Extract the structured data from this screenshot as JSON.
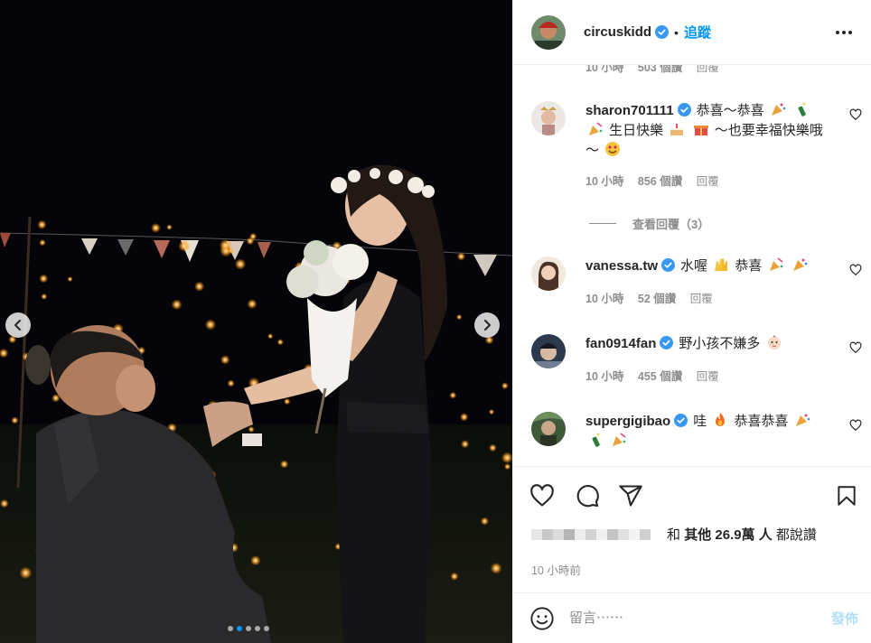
{
  "post": {
    "author": "circuskidd",
    "follow_label": "追蹤",
    "separator": "•"
  },
  "comments_partial_meta": {
    "time": "10 小時",
    "likes": "503 個讚",
    "reply": "回覆"
  },
  "comments": [
    {
      "user": "sharon701111",
      "line1": "恭喜～恭喜",
      "line2": "生日快樂",
      "line3": "～也要幸福快樂哦",
      "line4": "～",
      "time": "10 小時",
      "likes": "856 個讚",
      "reply": "回覆",
      "view_replies": "查看回覆（3）"
    },
    {
      "user": "vanessa.tw",
      "text_a": "水喔",
      "text_b": "恭喜",
      "time": "10 小時",
      "likes": "52 個讚",
      "reply": "回覆"
    },
    {
      "user": "fan0914fan",
      "text": "野小孩不嫌多",
      "time": "10 小時",
      "likes": "455 個讚",
      "reply": "回覆"
    },
    {
      "user": "supergigibao",
      "text_a": "哇",
      "text_b": "恭喜恭喜",
      "time": "10 小時",
      "likes": "",
      "reply": ""
    }
  ],
  "likes_summary": {
    "prefix": "和",
    "bold": "其他 26.9萬 人",
    "suffix": "都說讚"
  },
  "posted_ago": "10 小時前",
  "composer": {
    "placeholder": "留言⋯⋯",
    "post_label": "發佈"
  },
  "carousel": {
    "total": 5,
    "active_index": 1
  },
  "colors": {
    "accent": "#0095f6",
    "text": "#262626",
    "muted": "#8e8e8e",
    "verified": "#3897f0",
    "post_disabled": "#b2dffc"
  },
  "icons": [
    "chevron-left-icon",
    "chevron-right-icon",
    "verified-badge-icon",
    "more-icon",
    "heart-icon",
    "comment-icon",
    "share-icon",
    "bookmark-icon",
    "smiley-icon"
  ]
}
